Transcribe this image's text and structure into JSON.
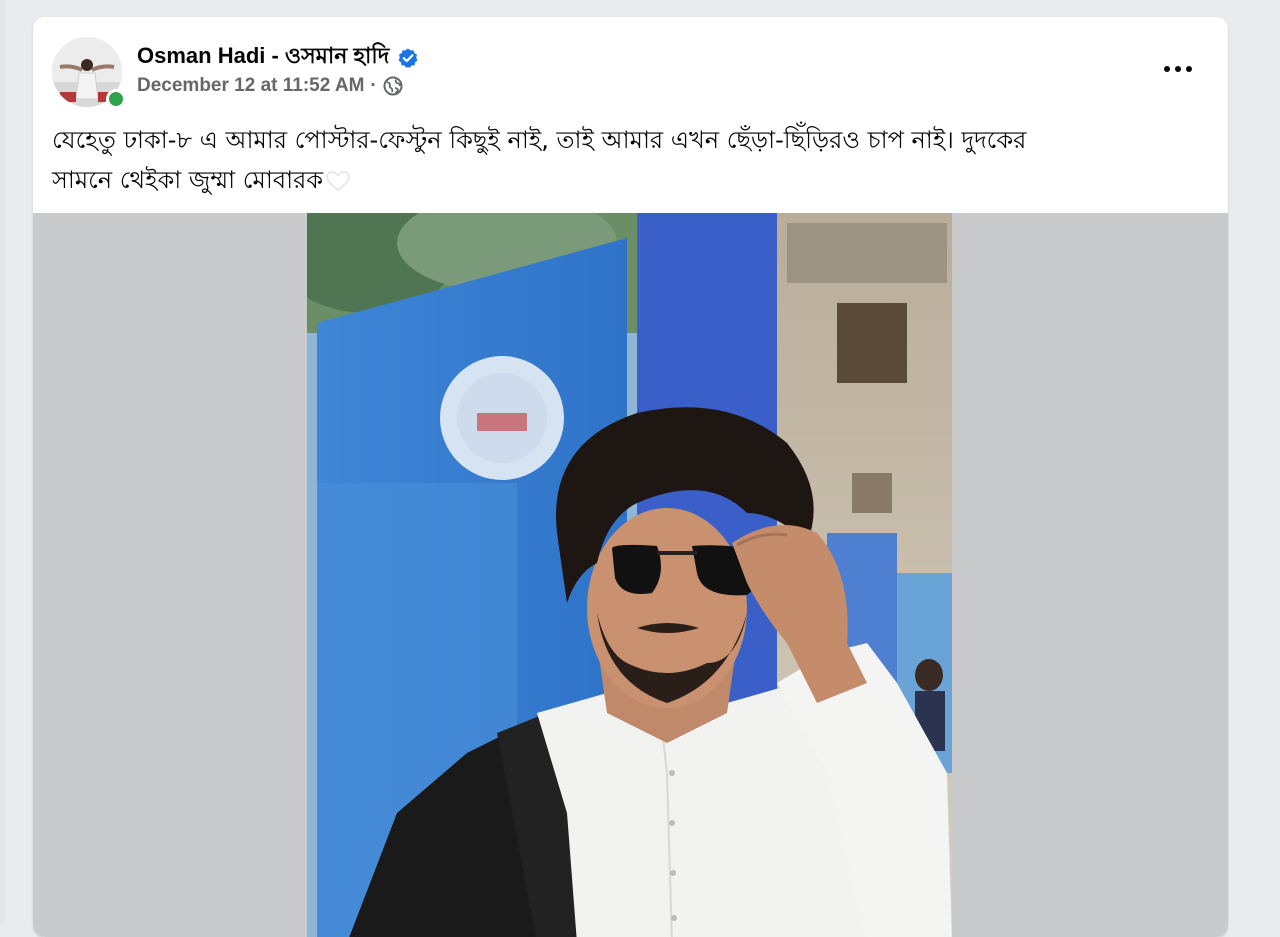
{
  "post": {
    "author_name": "Osman Hadi - ওসমান হাদি",
    "timestamp": "December 12 at 11:52 AM",
    "separator": "·",
    "verified": true,
    "audience_icon": "globe-icon",
    "more_icon": "more-options-icon",
    "text_line1": "যেহেতু ঢাকা-৮ এ আমার পোস্টার-ফেস্টুন কিছুই নাই, তাই আমার এখন ছেঁড়া-ছিঁড়িরও চাপ নাই। দুদকের",
    "text_line2": "সামনে থেইকা জুম্মা মোবারক",
    "text_emoji": "white-heart-icon",
    "accent_color": "#1b74e4",
    "online_color": "#31a24c"
  }
}
